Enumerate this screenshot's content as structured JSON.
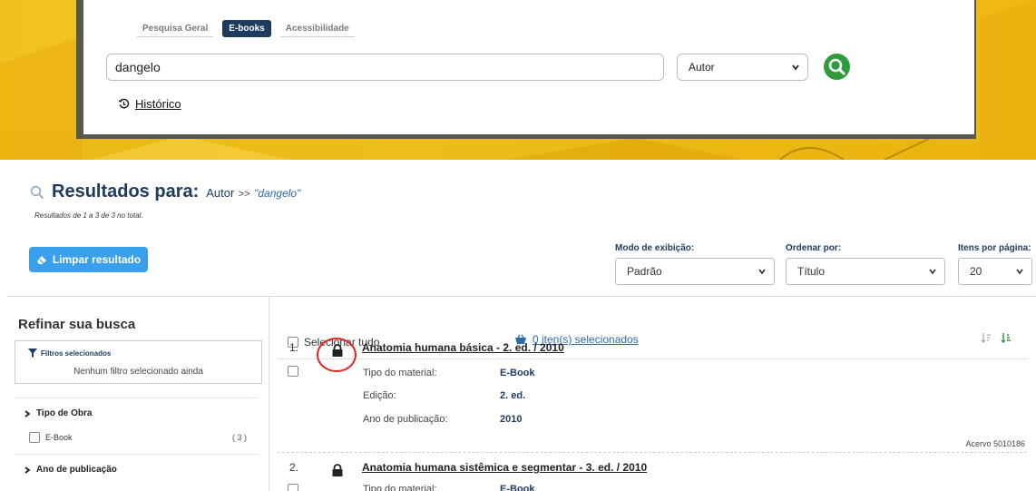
{
  "colors": {
    "navy": "#1d3a5f",
    "accent_blue": "#3aa0ee",
    "link_blue": "#2b6cb0",
    "search_green": "#2e9c3a",
    "highlight_red": "#e0231c",
    "banner_yellow": "#f2c21b"
  },
  "search": {
    "tabs": [
      {
        "label": "Pesquisa Geral",
        "active": false
      },
      {
        "label": "E-books",
        "active": true
      },
      {
        "label": "Acessibilidade",
        "active": false
      }
    ],
    "query": "dangelo",
    "field": "Autor",
    "search_icon": "magnifier-icon",
    "history_label": "Histórico"
  },
  "results": {
    "title": "Resultados para:",
    "field": "Autor",
    "separator": ">>",
    "query": "\"dangelo\"",
    "count_text": "Resultados de 1 a 3 de 3 no total.",
    "clear_label": "Limpar resultado"
  },
  "controls": {
    "display_mode_label": "Modo de exibição:",
    "display_mode_value": "Padrão",
    "order_label": "Ordenar por:",
    "order_value": "Título",
    "per_page_label": "Itens por página:",
    "per_page_value": "20"
  },
  "sidebar": {
    "title": "Refinar sua busca",
    "filters_title": "Filtros selecionados",
    "filters_empty": "Nenhum filtro selecionado ainda",
    "facets": [
      {
        "label": "Tipo de Obra",
        "items": [
          {
            "label": "E-Book",
            "count": "( 3 )"
          }
        ]
      },
      {
        "label": "Ano de publicação",
        "items": []
      }
    ]
  },
  "list": {
    "select_all": "Selecionar tudo",
    "selected_count": "0 iten(s) selecionados",
    "items": [
      {
        "num": "1.",
        "title": "Anatomia humana básica - 2. ed. / 2010",
        "meta": [
          {
            "label": "Tipo do material:",
            "value": "E-Book"
          },
          {
            "label": "Edição:",
            "value": "2. ed."
          },
          {
            "label": "Ano de publicação:",
            "value": "2010"
          }
        ],
        "acervo": "Acervo 5010186"
      },
      {
        "num": "2.",
        "title": "Anatomia humana sistêmica e segmentar - 3. ed. / 2010",
        "meta": [
          {
            "label": "Tipo do material:",
            "value": "E-Book"
          }
        ]
      }
    ]
  }
}
